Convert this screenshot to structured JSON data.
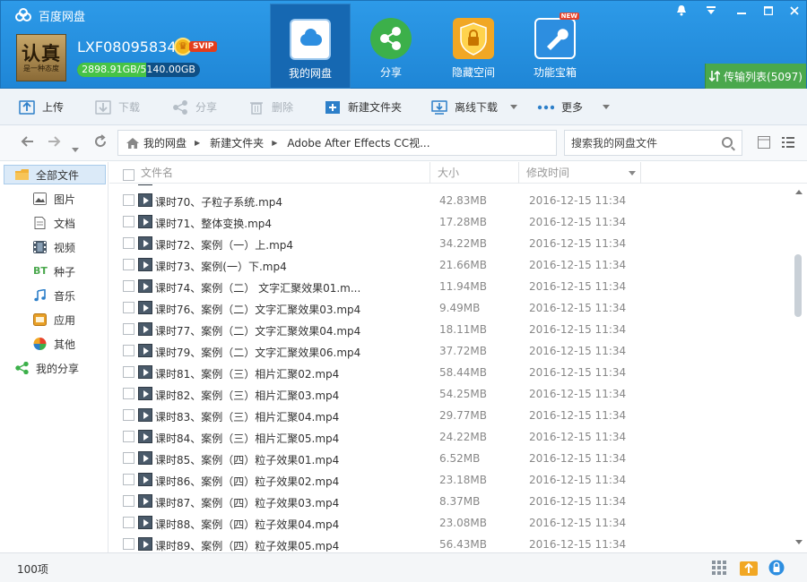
{
  "app": {
    "title": "百度网盘"
  },
  "user": {
    "avatar_big": "认真",
    "avatar_small": "是一种态度",
    "name": "LXF08095834",
    "badge": "SVIP",
    "quota_text": "2898.91GB/5140.00GB",
    "quota_used_fraction": 0.564
  },
  "nav": {
    "tabs": [
      {
        "label": "我的网盘",
        "icon": "cloud-icon",
        "active": true
      },
      {
        "label": "分享",
        "icon": "share-icon",
        "active": false
      },
      {
        "label": "隐藏空间",
        "icon": "lock-icon",
        "active": false
      },
      {
        "label": "功能宝箱",
        "icon": "toolbox-icon",
        "active": false,
        "badge": "NEW"
      }
    ],
    "transfer_label": "传输列表(5097)"
  },
  "toolbar": {
    "upload": "上传",
    "download": "下载",
    "share": "分享",
    "delete": "删除",
    "new_folder": "新建文件夹",
    "offline_download": "离线下载",
    "more": "更多"
  },
  "addressbar": {
    "crumbs": [
      "我的网盘",
      "新建文件夹",
      "Adobe After Effects CC视..."
    ],
    "search_placeholder": "搜索我的网盘文件"
  },
  "sidebar": {
    "items": [
      {
        "label": "全部文件",
        "icon": "folder-icon",
        "active": true
      },
      {
        "label": "图片",
        "icon": "image-icon"
      },
      {
        "label": "文档",
        "icon": "document-icon"
      },
      {
        "label": "视频",
        "icon": "video-icon"
      },
      {
        "label": "种子",
        "icon": "bt-icon",
        "icon_text": "BT"
      },
      {
        "label": "音乐",
        "icon": "music-icon"
      },
      {
        "label": "应用",
        "icon": "app-icon"
      },
      {
        "label": "其他",
        "icon": "other-icon"
      },
      {
        "label": "我的分享",
        "icon": "share-icon"
      }
    ]
  },
  "list": {
    "headers": {
      "name": "文件名",
      "size": "大小",
      "time": "修改时间"
    },
    "rows": [
      {
        "name": "课时70、子粒子系统.mp4",
        "size": "42.83MB",
        "time": "2016-12-15 11:34"
      },
      {
        "name": "课时71、整体变换.mp4",
        "size": "17.28MB",
        "time": "2016-12-15 11:34"
      },
      {
        "name": "课时72、案例（一）上.mp4",
        "size": "34.22MB",
        "time": "2016-12-15 11:34"
      },
      {
        "name": "课时73、案例(一）下.mp4",
        "size": "21.66MB",
        "time": "2016-12-15 11:34"
      },
      {
        "name": "课时74、案例（二） 文字汇聚效果01.m...",
        "size": "11.94MB",
        "time": "2016-12-15 11:34"
      },
      {
        "name": "课时76、案例（二）文字汇聚效果03.mp4",
        "size": "9.49MB",
        "time": "2016-12-15 11:34"
      },
      {
        "name": "课时77、案例（二）文字汇聚效果04.mp4",
        "size": "18.11MB",
        "time": "2016-12-15 11:34"
      },
      {
        "name": "课时79、案例（二）文字汇聚效果06.mp4",
        "size": "37.72MB",
        "time": "2016-12-15 11:34"
      },
      {
        "name": "课时81、案例（三）相片汇聚02.mp4",
        "size": "58.44MB",
        "time": "2016-12-15 11:34"
      },
      {
        "name": "课时82、案例（三）相片汇聚03.mp4",
        "size": "54.25MB",
        "time": "2016-12-15 11:34"
      },
      {
        "name": "课时83、案例（三）相片汇聚04.mp4",
        "size": "29.77MB",
        "time": "2016-12-15 11:34"
      },
      {
        "name": "课时84、案例（三）相片汇聚05.mp4",
        "size": "24.22MB",
        "time": "2016-12-15 11:34"
      },
      {
        "name": "课时85、案例（四）粒子效果01.mp4",
        "size": "6.52MB",
        "time": "2016-12-15 11:34"
      },
      {
        "name": "课时86、案例（四）粒子效果02.mp4",
        "size": "23.18MB",
        "time": "2016-12-15 11:34"
      },
      {
        "name": "课时87、案例（四）粒子效果03.mp4",
        "size": "8.37MB",
        "time": "2016-12-15 11:34"
      },
      {
        "name": "课时88、案例（四）粒子效果04.mp4",
        "size": "23.08MB",
        "time": "2016-12-15 11:34"
      },
      {
        "name": "课时89、案例（四）粒子效果05.mp4",
        "size": "56.43MB",
        "time": "2016-12-15 11:34"
      }
    ]
  },
  "status": {
    "count": "100项"
  },
  "colors": {
    "accent": "#1f86d6",
    "active_tab": "#1668b2",
    "transfer": "#4aa84d",
    "svip": "#e33d1c"
  }
}
